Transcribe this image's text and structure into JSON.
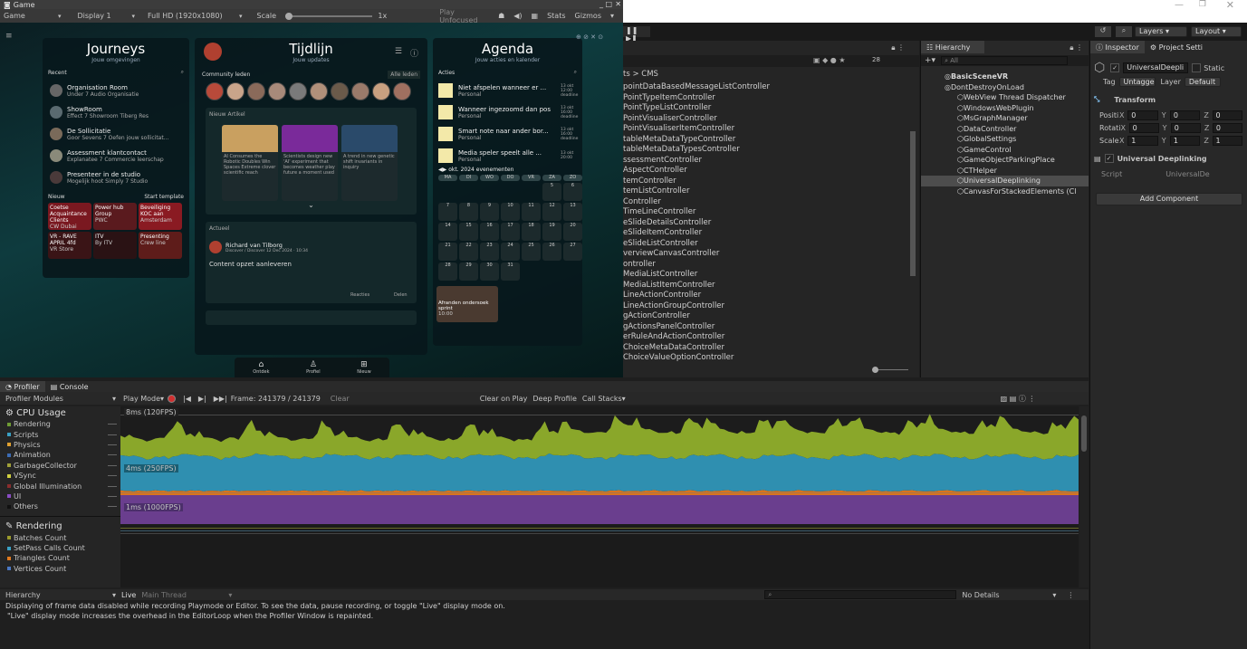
{
  "game_window": {
    "title": "Game",
    "toolbar": {
      "view": "Game",
      "display": "Display 1",
      "resolution": "Full HD (1920x1080)",
      "scale_label": "Scale",
      "scale_value": "1x",
      "play_mode": "Play Unfocused",
      "stats": "Stats",
      "gizmos": "Gizmos"
    }
  },
  "journeys": {
    "title": "Journeys",
    "subtitle": "Jouw omgevingen",
    "recent_label": "Recent",
    "items": [
      {
        "title": "Organisation Room",
        "sub": "Under 7 Audio Organisatie"
      },
      {
        "title": "ShowRoom",
        "sub": "Effect 7 Showroom Tiberg Res"
      },
      {
        "title": "De Sollicitatie",
        "sub": "Goor Sevens 7 Oefen jouw sollicitat..."
      },
      {
        "title": "Assessment klantcontact",
        "sub": "Explanatee 7 Commercie leerschap"
      },
      {
        "title": "Presenteer in de studio",
        "sub": "Mogelijk hoot Simply 7 Studio"
      }
    ],
    "new_label": "Nieuw",
    "start_label": "Start template",
    "tiles": [
      {
        "label": "Coetse Acquaintance Clients",
        "sub": "CW Dubai",
        "color": "#7a1820"
      },
      {
        "label": "Power hub Group",
        "sub": "PWC",
        "color": "#5a1a1e"
      },
      {
        "label": "Beveiliging KOC aan",
        "sub": "Amsterdam",
        "color": "#8a1a22"
      },
      {
        "label": "VR - RAVE APRIL 4fd",
        "sub": "VR Store",
        "color": "#3a1416"
      },
      {
        "label": "ITV",
        "sub": "By ITV",
        "color": "#2a1214"
      },
      {
        "label": "Presenting",
        "sub": "Crew line",
        "color": "#5e1c1a"
      }
    ]
  },
  "tijdlijn": {
    "title": "Tijdlijn",
    "subtitle": "Jouw updates",
    "community_label": "Community leden",
    "filter_label": "Alle leden",
    "new_post_label": "Nieuw Artikel",
    "cards": [
      "AI Consumes the Robotic Doubles Win Spaces Extreme clover scientific reach",
      "Scientists design new 'AI' experiment that becomes weather play future a moment used",
      "A trend in new genetic shift invariants in inquiry"
    ],
    "post_tag": "Actueel",
    "post_author": "Richard van Tilborg",
    "post_meta": "Discover / Discover 12 Dec 2024 · 10:34",
    "post_body": "Content opzet aanleveren",
    "post_like": "Reacties",
    "post_share": "Delen",
    "nav": [
      {
        "icon": "home",
        "label": "Ontdek"
      },
      {
        "icon": "user",
        "label": "Profiel"
      },
      {
        "icon": "plus",
        "label": "Nieuw"
      }
    ]
  },
  "agenda": {
    "title": "Agenda",
    "subtitle": "Jouw acties en kalender",
    "acties_label": "Acties",
    "items": [
      {
        "title": "Niet afspelen wanneer er ...",
        "sub": "Personal",
        "date": "13 okt 12:00 deadline"
      },
      {
        "title": "Wanneer ingezoomd dan pos",
        "sub": "Personal",
        "date": "13 okt 16:00 deadline"
      },
      {
        "title": "Smart note naar ander bor...",
        "sub": "Personal",
        "date": "13 okt 16:00 deadline"
      },
      {
        "title": "Media speler speelt alle ...",
        "sub": "Personal",
        "date": "13 okt 20:00"
      }
    ],
    "month": "okt. 2024",
    "events": "evenementen",
    "weekdays": [
      "MA",
      "DI",
      "WO",
      "DO",
      "VR",
      "ZA",
      "ZO"
    ],
    "days": [
      "",
      "",
      "",
      "",
      "",
      "5",
      "6",
      "7",
      "8",
      "9",
      "10",
      "11",
      "12",
      "13",
      "14",
      "15",
      "16",
      "17",
      "18",
      "19",
      "20",
      "21",
      "22",
      "23",
      "24",
      "25",
      "26",
      "27",
      "28",
      "29",
      "30",
      "31",
      "",
      "",
      ""
    ],
    "event_title": "Afranden ondersoek sprint",
    "event_sub": "10:00"
  },
  "editor": {
    "scene_toolbar": {
      "layers": "Layers",
      "layout": "Layout"
    },
    "project_breadcrumb": "ts > CMS",
    "project_items": [
      "pointDataBasedMessageListController",
      "PointTypeItemController",
      "PointTypeListController",
      "PointVisualiserController",
      "PointVisualiserItemController",
      "tableMetaDataTypeController",
      "tableMetaDataTypesController",
      "ssessmentController",
      "AspectController",
      "temController",
      "temListController",
      "Controller",
      "TimeLineController",
      "eSlideDetailsController",
      "eSlideItemController",
      "eSlideListController",
      "verviewCanvasController",
      "ontroller",
      "MediaListController",
      "MediaListItemController",
      "LineActionController",
      "LineActionGroupController",
      "gActionController",
      "gActionsPanelController",
      "erRuleAndActionController",
      "ChoiceMetaDataController",
      "ChoiceValueOptionController"
    ],
    "project_count": "28",
    "search_placeholder": "All"
  },
  "hierarchy": {
    "tab": "Hierarchy",
    "items": [
      {
        "label": "BasicSceneVR",
        "indent": 0,
        "bold": true
      },
      {
        "label": "DontDestroyOnLoad",
        "indent": 0,
        "bold": false
      },
      {
        "label": "WebView Thread Dispatcher",
        "indent": 1
      },
      {
        "label": "WindowsWebPlugin",
        "indent": 1
      },
      {
        "label": "MsGraphManager",
        "indent": 1
      },
      {
        "label": "DataController",
        "indent": 1
      },
      {
        "label": "GlobalSettings",
        "indent": 1
      },
      {
        "label": "GameControl",
        "indent": 1
      },
      {
        "label": "GameObjectParkingPlace",
        "indent": 1
      },
      {
        "label": "CTHelper",
        "indent": 1
      },
      {
        "label": "UniversalDeeplinking",
        "indent": 1,
        "selected": true
      },
      {
        "label": "CanvasForStackedElements (Cl",
        "indent": 1
      }
    ]
  },
  "inspector": {
    "tab": "Inspector",
    "tab2": "Project Setti",
    "object_name": "UniversalDeepli",
    "static": "Static",
    "tag_label": "Tag",
    "tag_value": "Untagge",
    "layer_label": "Layer",
    "layer_value": "Default",
    "transform": "Transform",
    "rows": [
      {
        "label": "Positi",
        "x": "0",
        "y": "0",
        "z": "0"
      },
      {
        "label": "Rotati",
        "x": "0",
        "y": "0",
        "z": "0"
      },
      {
        "label": "Scale",
        "x": "1",
        "y": "1",
        "z": "1"
      }
    ],
    "component": "Universal Deeplinking",
    "script_label": "Script",
    "script_value": "UniversalDe",
    "add_component": "Add Component"
  },
  "profiler": {
    "tab": "Profiler",
    "tab2": "Console",
    "modules": "Profiler Modules",
    "play_mode": "Play Mode",
    "frame": "Frame: 241379 / 241379",
    "clear": "Clear",
    "clear_on_play": "Clear on Play",
    "deep_profile": "Deep Profile",
    "call_stacks": "Call Stacks",
    "cpu_label": "CPU Usage",
    "cpu_items": [
      {
        "name": "Rendering",
        "color": "#6e9c34"
      },
      {
        "name": "Scripts",
        "color": "#3aa0c4"
      },
      {
        "name": "Physics",
        "color": "#e0a030"
      },
      {
        "name": "Animation",
        "color": "#3c6cb4"
      },
      {
        "name": "GarbageCollector",
        "color": "#a0a038"
      },
      {
        "name": "VSync",
        "color": "#d0d040"
      },
      {
        "name": "Global Illumination",
        "color": "#8a2d2d"
      },
      {
        "name": "UI",
        "color": "#8a4cc4"
      },
      {
        "name": "Others",
        "color": "#111111"
      }
    ],
    "rendering_label": "Rendering",
    "rendering_items": [
      {
        "name": "Batches Count",
        "color": "#9b9b2c"
      },
      {
        "name": "SetPass Calls Count",
        "color": "#3aa0c4"
      },
      {
        "name": "Triangles Count",
        "color": "#e07a1e"
      },
      {
        "name": "Vertices Count",
        "color": "#4a78c4"
      }
    ],
    "chart_labels": [
      "8ms (120FPS)",
      "4ms (250FPS)",
      "1ms (1000FPS)"
    ],
    "bottom_view": "Hierarchy",
    "live": "Live",
    "thread": "Main Thread",
    "no_details": "No Details",
    "message1": "Displaying of frame data disabled while recording Playmode or Editor. To see the data, pause recording, or toggle \"Live\" display mode on.",
    "message2": "\"Live\" display mode increases the overhead in the EditorLoop when the Profiler Window is repainted."
  }
}
